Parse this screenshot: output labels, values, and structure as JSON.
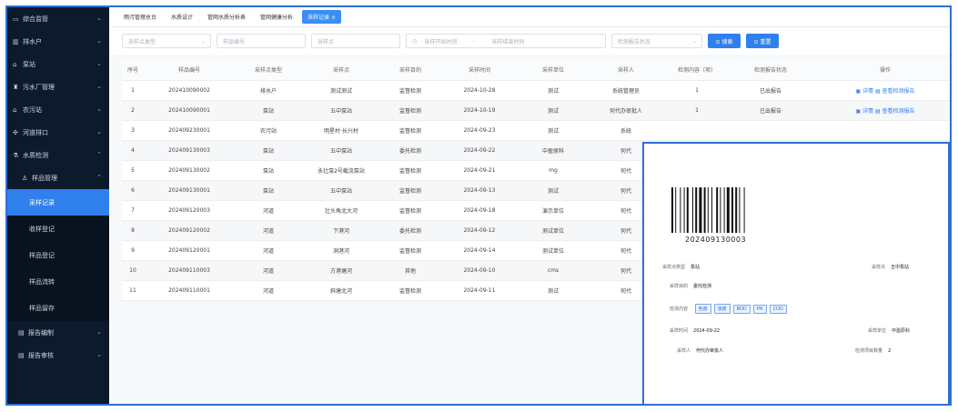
{
  "sidebar": {
    "items": [
      {
        "label": "综合监管",
        "icon": "monitor-icon"
      },
      {
        "label": "排水户",
        "icon": "building-icon"
      },
      {
        "label": "泵站",
        "icon": "home-icon"
      },
      {
        "label": "污水厂管理",
        "icon": "factory-icon"
      },
      {
        "label": "农污站",
        "icon": "home-icon"
      },
      {
        "label": "河道排口",
        "icon": "outlet-icon"
      },
      {
        "label": "水质检测",
        "icon": "flask-icon"
      },
      {
        "label": "样品管理",
        "icon": "user-icon"
      }
    ],
    "subitems": [
      "采样记录",
      "收样登记",
      "样品登记",
      "样品流转",
      "样品留存"
    ],
    "bottom_items": [
      {
        "label": "报告编制",
        "icon": "report-icon"
      },
      {
        "label": "报告审核",
        "icon": "report-icon"
      }
    ]
  },
  "tabs": [
    "雨污管理总台",
    "水质设计",
    "管网水质分析表",
    "管网健康分析",
    "采样记录 ×"
  ],
  "filters": {
    "sample_type_placeholder": "采样点类型",
    "sample_no_placeholder": "样品编号",
    "sample_point_placeholder": "采样点",
    "start_time_placeholder": "采样开始时间",
    "date_sep": "-",
    "end_time_placeholder": "采样结束时间",
    "status_placeholder": "检测报告状态",
    "search_label": "⊙ 搜索",
    "reset_label": "⊙ 重置"
  },
  "table": {
    "headers": [
      "序号",
      "样品编号",
      "采样点类型",
      "采样点",
      "采样目的",
      "采样时间",
      "采样单位",
      "采样人",
      "检测内容（项）",
      "检测报告状态",
      "操作"
    ],
    "rows": [
      [
        "1",
        "202410090002",
        "排水户",
        "测试测试",
        "监督检测",
        "2024-10-28",
        "测试",
        "系统管理员",
        "1",
        "已出报告",
        "▣ 详情   ▤ 查看检测报告"
      ],
      [
        "2",
        "202410090001",
        "泵站",
        "五中泵站",
        "监督检测",
        "2024-10-19",
        "测试",
        "何代办审批人",
        "1",
        "已出报告",
        "▣ 详情   ▤ 查看检测报告"
      ],
      [
        "3",
        "202409230001",
        "农污站",
        "明星村·长兴村",
        "监督检测",
        "2024-09-23",
        "测试",
        "系统",
        "",
        "",
        ""
      ],
      [
        "4",
        "202409130003",
        "泵站",
        "五中泵站",
        "委托检测",
        "2024-09-22",
        "中盈原科",
        "何代",
        "",
        "",
        ""
      ],
      [
        "5",
        "202409130002",
        "泵站",
        "永壮泵2号截流泵站",
        "监督检测",
        "2024-09-21",
        "mg",
        "何代",
        "",
        "",
        ""
      ],
      [
        "6",
        "202409130001",
        "泵站",
        "五中泵站",
        "监督检测",
        "2024-09-13",
        "测试",
        "何代",
        "",
        "",
        ""
      ],
      [
        "7",
        "202409120003",
        "河道",
        "壮头角北大河",
        "监督检测",
        "2024-09-18",
        "演示单位",
        "何代",
        "",
        "",
        ""
      ],
      [
        "8",
        "202409120002",
        "河道",
        "下港河",
        "委托检测",
        "2024-09-12",
        "测试单位",
        "何代",
        "",
        "",
        ""
      ],
      [
        "9",
        "202409120001",
        "河道",
        "洞港河",
        "监督检测",
        "2024-09-14",
        "测试单位",
        "何代",
        "",
        "",
        ""
      ],
      [
        "10",
        "202409110003",
        "河道",
        "方港塘河",
        "其他",
        "2024-09-10",
        "cms",
        "何代",
        "",
        "",
        ""
      ],
      [
        "11",
        "202409110001",
        "河道",
        "斜塘北河",
        "监督检测",
        "2024-09-11",
        "测试",
        "何代",
        "",
        "",
        ""
      ]
    ]
  },
  "popup": {
    "barcode_number": "202409130003",
    "type_label": "采样点类型",
    "type_value": "泵站",
    "point_label": "采样点",
    "point_value": "五中泵站",
    "purpose_label": "采样目的",
    "purpose_value": "委托检测",
    "content_label": "检测内容",
    "tags": [
      "色度",
      "浊度",
      "BOD",
      "PH",
      "COD"
    ],
    "time_label": "采样时间",
    "time_value": "2024-09-22",
    "unit_label": "采样单位",
    "unit_value": "中盈原科",
    "person_label": "采样人",
    "person_value": "何代办审批人",
    "count_label": "检测项目数量",
    "count_value": "2"
  },
  "colors": {
    "sidebar_bg": "#0d1a2e",
    "accent": "#2f80ed",
    "frame": "#2f6fd6"
  }
}
